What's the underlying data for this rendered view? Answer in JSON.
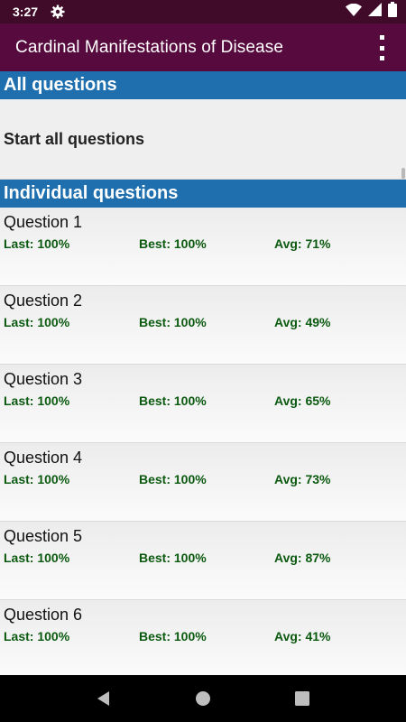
{
  "status_bar": {
    "time": "3:27"
  },
  "app_bar": {
    "title": "Cardinal Manifestations of Disease"
  },
  "all_questions": {
    "header": "All questions",
    "start_label": "Start all questions"
  },
  "individual": {
    "header": "Individual questions",
    "questions": [
      {
        "title": "Question 1",
        "last": "Last: 100%",
        "best": "Best: 100%",
        "avg": "Avg: 71%"
      },
      {
        "title": "Question 2",
        "last": "Last: 100%",
        "best": "Best: 100%",
        "avg": "Avg: 49%"
      },
      {
        "title": "Question 3",
        "last": "Last: 100%",
        "best": "Best: 100%",
        "avg": "Avg: 65%"
      },
      {
        "title": "Question 4",
        "last": "Last: 100%",
        "best": "Best: 100%",
        "avg": "Avg: 73%"
      },
      {
        "title": "Question 5",
        "last": "Last: 100%",
        "best": "Best: 100%",
        "avg": "Avg: 87%"
      },
      {
        "title": "Question 6",
        "last": "Last: 100%",
        "best": "Best: 100%",
        "avg": "Avg: 41%"
      }
    ]
  },
  "icons": {
    "status": [
      "gear-icon",
      "wifi-icon",
      "signal-icon",
      "battery-icon"
    ],
    "nav": [
      "back-icon",
      "home-icon",
      "recents-icon"
    ],
    "menu": "overflow-menu-icon"
  },
  "colors": {
    "status_bar": "#3f0b29",
    "app_bar": "#570a3d",
    "section_header": "#1f6fae",
    "stat_text": "#0b5a10"
  }
}
